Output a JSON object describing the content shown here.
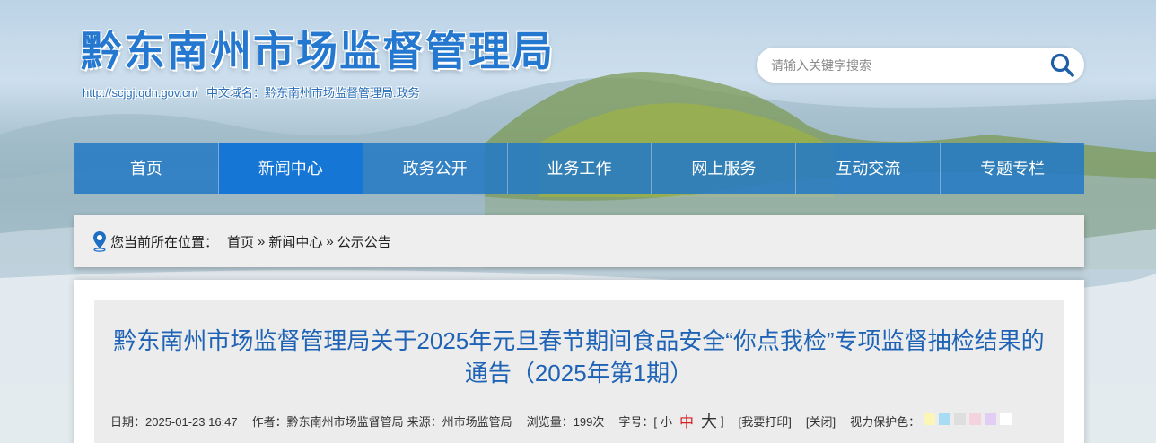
{
  "header": {
    "site_title": "黔东南州市场监督管理局",
    "url_text": "http://scjgj.qdn.gov.cn/",
    "cn_domain_label": "中文域名：黔东南州市场监督管理局.政务"
  },
  "search": {
    "placeholder": "请输入关键字搜索"
  },
  "nav": {
    "items": [
      {
        "label": "首页"
      },
      {
        "label": "新闻中心"
      },
      {
        "label": "政务公开"
      },
      {
        "label": "业务工作"
      },
      {
        "label": "网上服务"
      },
      {
        "label": "互动交流"
      },
      {
        "label": "专题专栏"
      }
    ],
    "active_index": 1
  },
  "breadcrumb": {
    "prefix": "您当前所在位置：",
    "items": [
      "首页",
      "新闻中心",
      "公示公告"
    ],
    "separator": "»"
  },
  "article": {
    "title": "黔东南州市场监督管理局关于2025年元旦春节期间食品安全“你点我检”专项监督抽检结果的通告（2025年第1期）",
    "date": "日期：2025-01-23 16:47",
    "author": "作者：黔东南州市场监督管局",
    "source": "来源：州市场监管局",
    "views": "浏览量：199次",
    "font_size_label": "字号：[",
    "font_small": "小",
    "font_medium": "中",
    "font_large": "大",
    "font_close": "]",
    "print": "[我要打印]",
    "close": "[关闭]",
    "eye_protect_label": "视力保护色：",
    "swatch_colors": [
      "#fbf6b6",
      "#a8dcf2",
      "#dedede",
      "#f5d2e0",
      "#e2cdf5",
      "#ffffff"
    ]
  },
  "colors": {
    "title_blue": "#2478d0",
    "nav_blue": "#267ac4",
    "nav_active": "#1676d6",
    "article_title": "#1e63b5"
  }
}
